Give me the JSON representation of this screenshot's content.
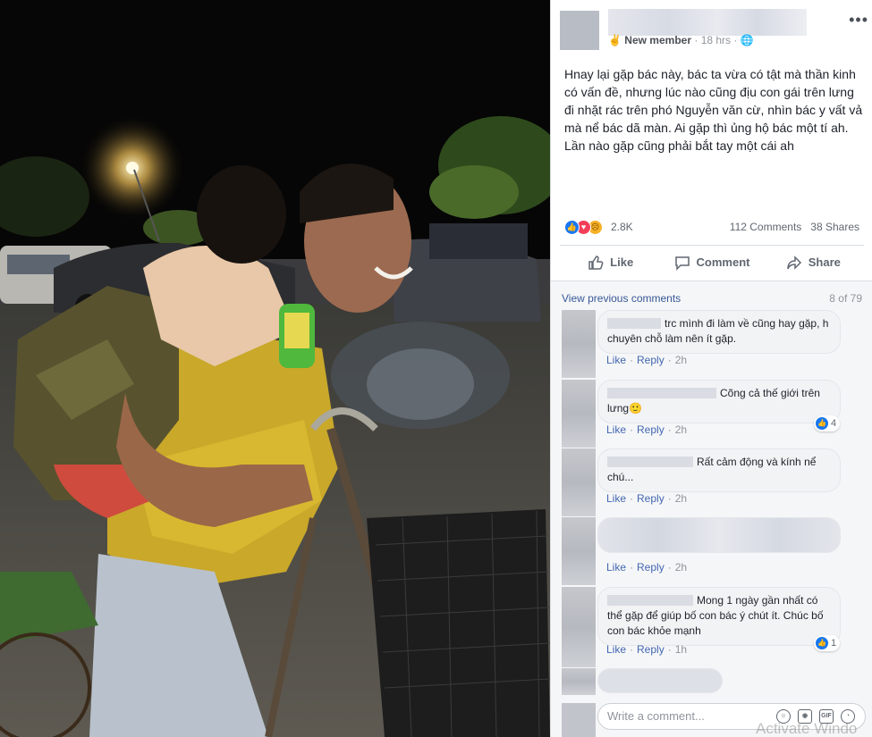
{
  "post": {
    "badge_label": "New member",
    "time": "18 hrs",
    "privacy_icon": "globe-icon",
    "text": "Hnay lại gặp bác này, bác ta vừa có tật mà thần kinh có vấn đề, nhưng lúc nào cũng địu con gái trên lưng đi nhặt rác trên phó Nguyễn văn cừ, nhìn bác y vất vả mà nể bác dã màn. Ai gặp thì ủng hộ bác một tí ah. Lần nào gặp cũng phải bắt tay một cái ah",
    "reaction_count": "2.8K",
    "comments_count": "112 Comments",
    "shares_count": "38 Shares"
  },
  "actions": {
    "like": "Like",
    "comment": "Comment",
    "share": "Share"
  },
  "comments": {
    "view_previous": "View previous comments",
    "page_count": "8 of 79",
    "items": [
      {
        "text": "trc mình đi làm về cũng hay gặp, h chuyên chỗ làm nên ít gặp.",
        "like": "Like",
        "reply": "Reply",
        "time": "2h"
      },
      {
        "text": "Cõng cả thế giới trên lưng🙂",
        "like": "Like",
        "reply": "Reply",
        "time": "2h",
        "likes": "4"
      },
      {
        "text": "Rất cảm động và kính nể chú...",
        "like": "Like",
        "reply": "Reply",
        "time": "2h"
      },
      {
        "text": "",
        "like": "Like",
        "reply": "Reply",
        "time": "2h"
      },
      {
        "text": "Mong 1 ngày gần nhất có thể gặp để giúp bố con bác ý chút ít. Chúc bố con bác khỏe mạnh",
        "like": "Like",
        "reply": "Reply",
        "time": "1h",
        "likes": "1"
      }
    ],
    "write_placeholder": "Write a comment...",
    "write_icons": [
      "smiley-icon",
      "camera-icon",
      "gif-icon",
      "sticker-icon"
    ]
  },
  "watermark": "Activate Windo",
  "colors": {
    "link": "#385898",
    "like_blue": "#1877f2",
    "love_red": "#f33e58"
  }
}
